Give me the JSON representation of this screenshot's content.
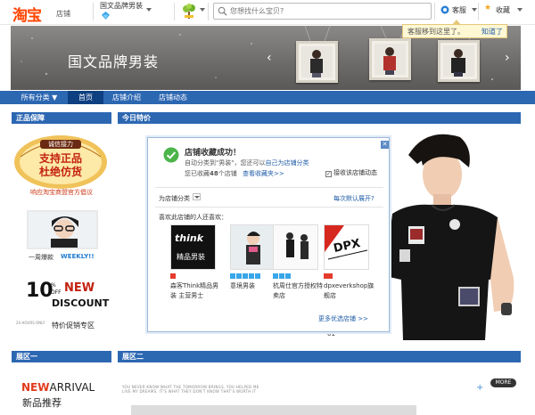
{
  "topbar": {
    "logo": "淘宝",
    "logo_sub": "店铺",
    "shop_name": "国文品牌男装",
    "search_placeholder": "您想找什么宝贝?",
    "kefu": "客服",
    "favorite": "收藏"
  },
  "tooltip": {
    "text": "客服移到这里了。",
    "link": "知道了"
  },
  "banner": {
    "title": "国文品牌男装"
  },
  "nav": {
    "items": [
      {
        "label": "所有分类 ▼"
      },
      {
        "label": "首页"
      },
      {
        "label": "店铺介绍"
      },
      {
        "label": "店铺动态"
      }
    ]
  },
  "sections": {
    "authentic": "正品保障",
    "today_special": "今日特价",
    "zone1": "展区一",
    "zone2": "展区二"
  },
  "left": {
    "badge_top": "诚信接力",
    "badge_line1": "支持正品",
    "badge_line2": "杜绝仿货",
    "badge_caption": "响应淘宝商盟官方倡议",
    "weekly_label": "一周爆款",
    "weekly_en": "WEEKLY!!",
    "discount_num": "10",
    "discount_pct": "%",
    "discount_off": "OFF",
    "discount_new": "NEW",
    "discount_word": "DISCOUNT",
    "discount_small": "24 HOURS ONLY",
    "discount_zone": "特价促销专区"
  },
  "popup": {
    "title": "店铺收藏成功！",
    "line1_a": "自动分类到\"男装\"，您还可以",
    "line1_link": "自己为店铺分类",
    "line2_a": "您已收藏",
    "line2_count": "48",
    "line2_b": "个店铺",
    "line2_link": "查看收藏夹>>",
    "checkbox_label": "接收该店铺动态",
    "category_label": "为店铺分类",
    "default_link": "每次默认展开?",
    "also_like": "喜欢此店铺的人还喜欢：",
    "products": [
      {
        "name": "森客Think精品男装 主营男士",
        "thumb_text_1": "think",
        "thumb_text_2": "精品男装"
      },
      {
        "name": "意境男装",
        "thumb_text_1": "",
        "thumb_text_2": ""
      },
      {
        "name": "杭周仕官方授权特卖店",
        "thumb_text_1": "",
        "thumb_text_2": ""
      },
      {
        "name": "dpxeverkshop旗舰店",
        "thumb_text_1": "DPX",
        "thumb_text_2": ""
      }
    ],
    "more_shops": "更多优选店铺 >>"
  },
  "bottom": {
    "new_word": "NEW",
    "arrival_word": "ARRIVAL",
    "new_sub": "新品推荐",
    "more": "MORE",
    "fine_print": "YOU NEVER KNOW WHAT THE TOMORROW BRINGS. YOU HELPED ME LIVE MY DREAMS. IT'S WHAT THEY DON'T KNOW THAT'S WORTH IT",
    "carousel_marker": "01"
  },
  "colors": {
    "nav_blue": "#2c67b2",
    "brand_orange": "#ff4400",
    "link_blue": "#1f5ca8"
  }
}
